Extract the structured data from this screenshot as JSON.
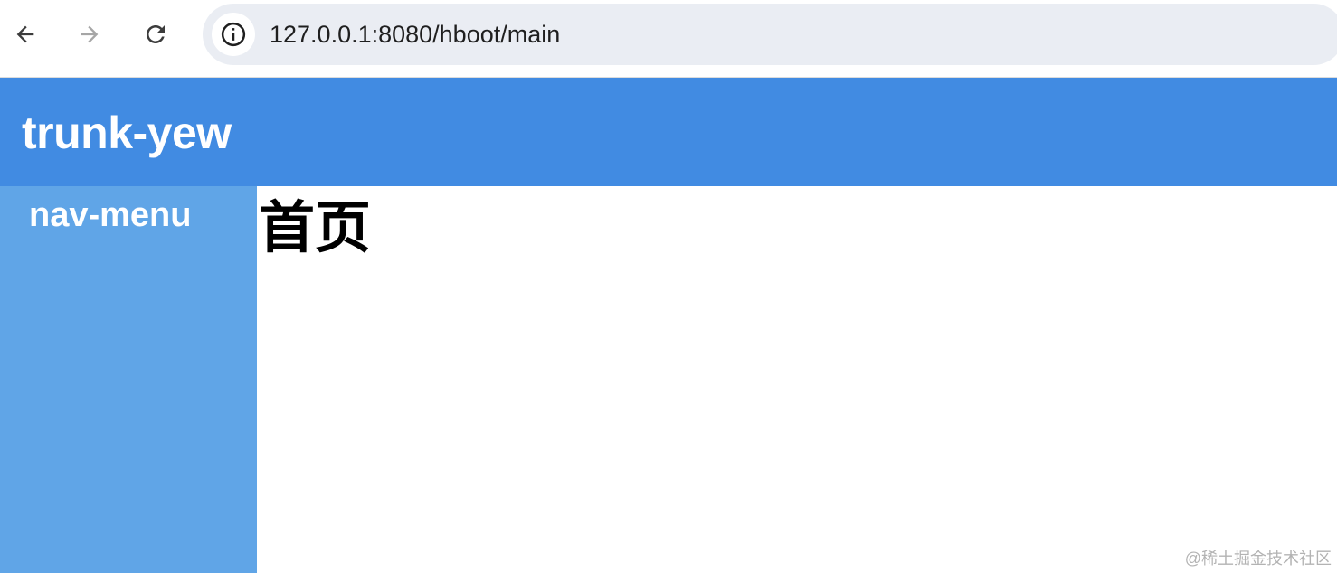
{
  "browser": {
    "url": "127.0.0.1:8080/hboot/main",
    "icons": {
      "back": "arrow-left-icon",
      "forward": "arrow-right-icon",
      "reload": "reload-icon",
      "site_info": "info-icon"
    }
  },
  "app": {
    "title": "trunk-yew",
    "header_color": "#418be2",
    "sidebar_color": "#60a5e7"
  },
  "sidebar": {
    "title": "nav-menu"
  },
  "main": {
    "heading": "首页"
  },
  "watermark": "@稀土掘金技术社区"
}
